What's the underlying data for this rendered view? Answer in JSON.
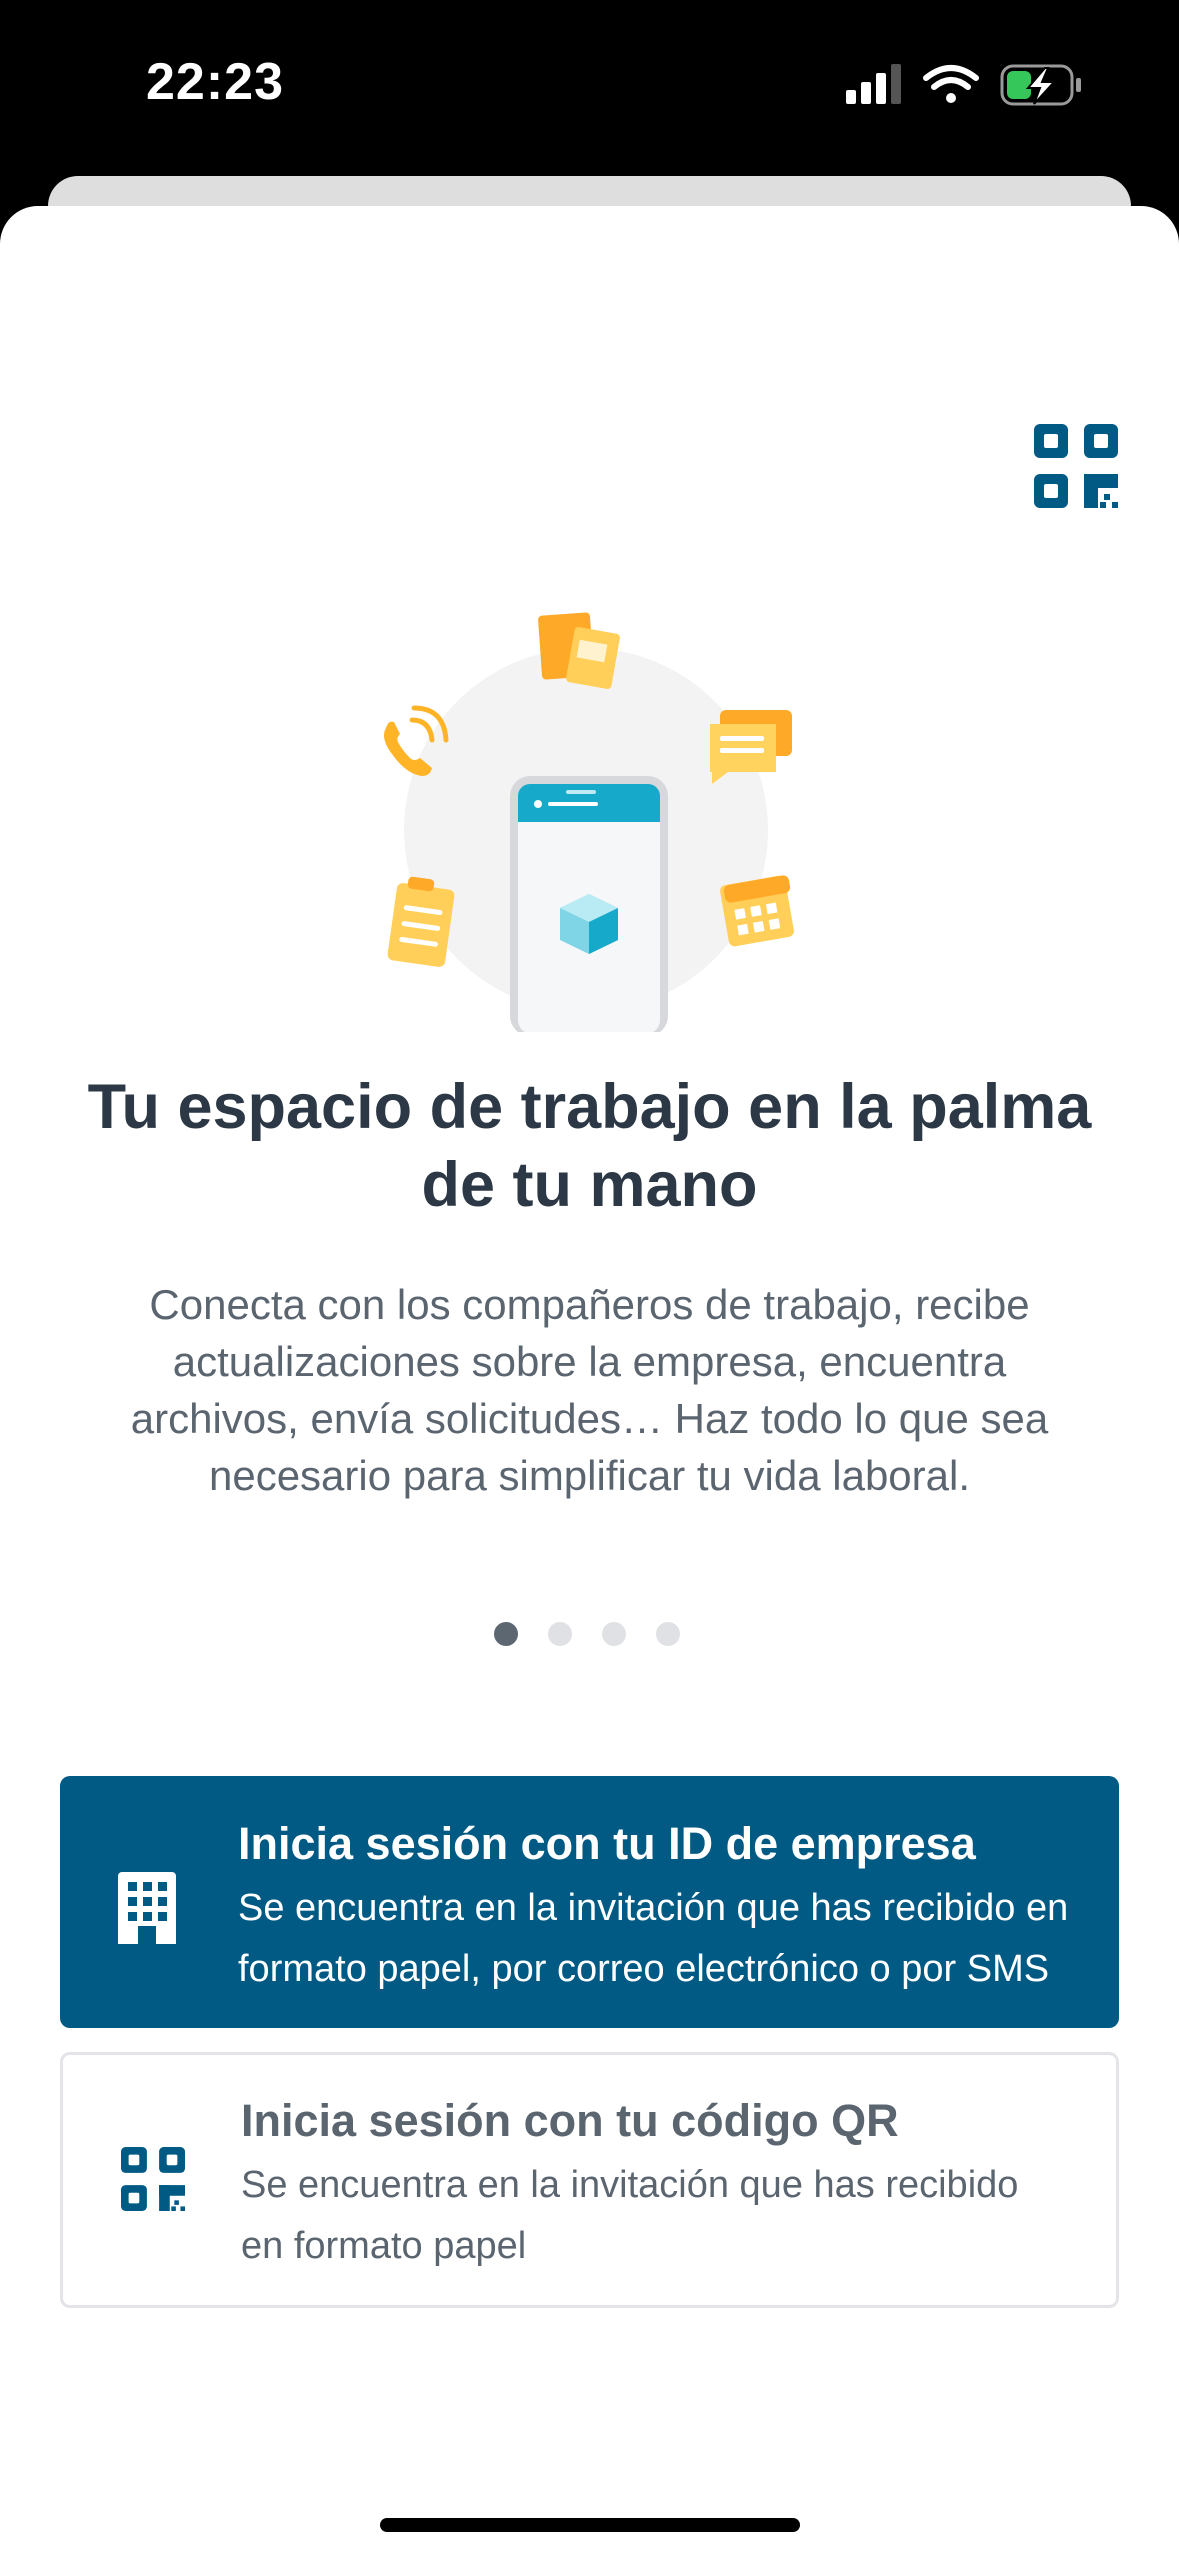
{
  "status_bar": {
    "time": "22:23"
  },
  "hero": {
    "title_line1": "Tu espacio de trabajo en la palma",
    "title_line2": "de tu mano",
    "description_lines": [
      "Conecta con los compañeros de trabajo, recibe",
      "actualizaciones sobre la empresa, encuentra",
      "archivos, envía solicitudes… Haz todo lo que sea",
      "necesario para simplificar tu vida laboral."
    ]
  },
  "pagination": {
    "total": 4,
    "current": 1
  },
  "login_company": {
    "title": "Inicia sesión con tu ID de empresa",
    "subtitle_line1": "Se encuentra en la invitación que has recibido en",
    "subtitle_line2": "formato papel, por correo electrónico o por SMS"
  },
  "login_qr": {
    "title": "Inicia sesión con tu código QR",
    "subtitle_line1": "Se encuentra en la invitación que has recibido",
    "subtitle_line2": "en formato papel"
  },
  "colors": {
    "primary": "#005a84",
    "text_dark": "#2c3845",
    "text_muted": "#5b6570",
    "accent_yellow": "#ffc23a"
  },
  "icons": [
    "qr-code-icon",
    "building-icon",
    "signal-icon",
    "wifi-icon",
    "battery-charging-icon"
  ]
}
